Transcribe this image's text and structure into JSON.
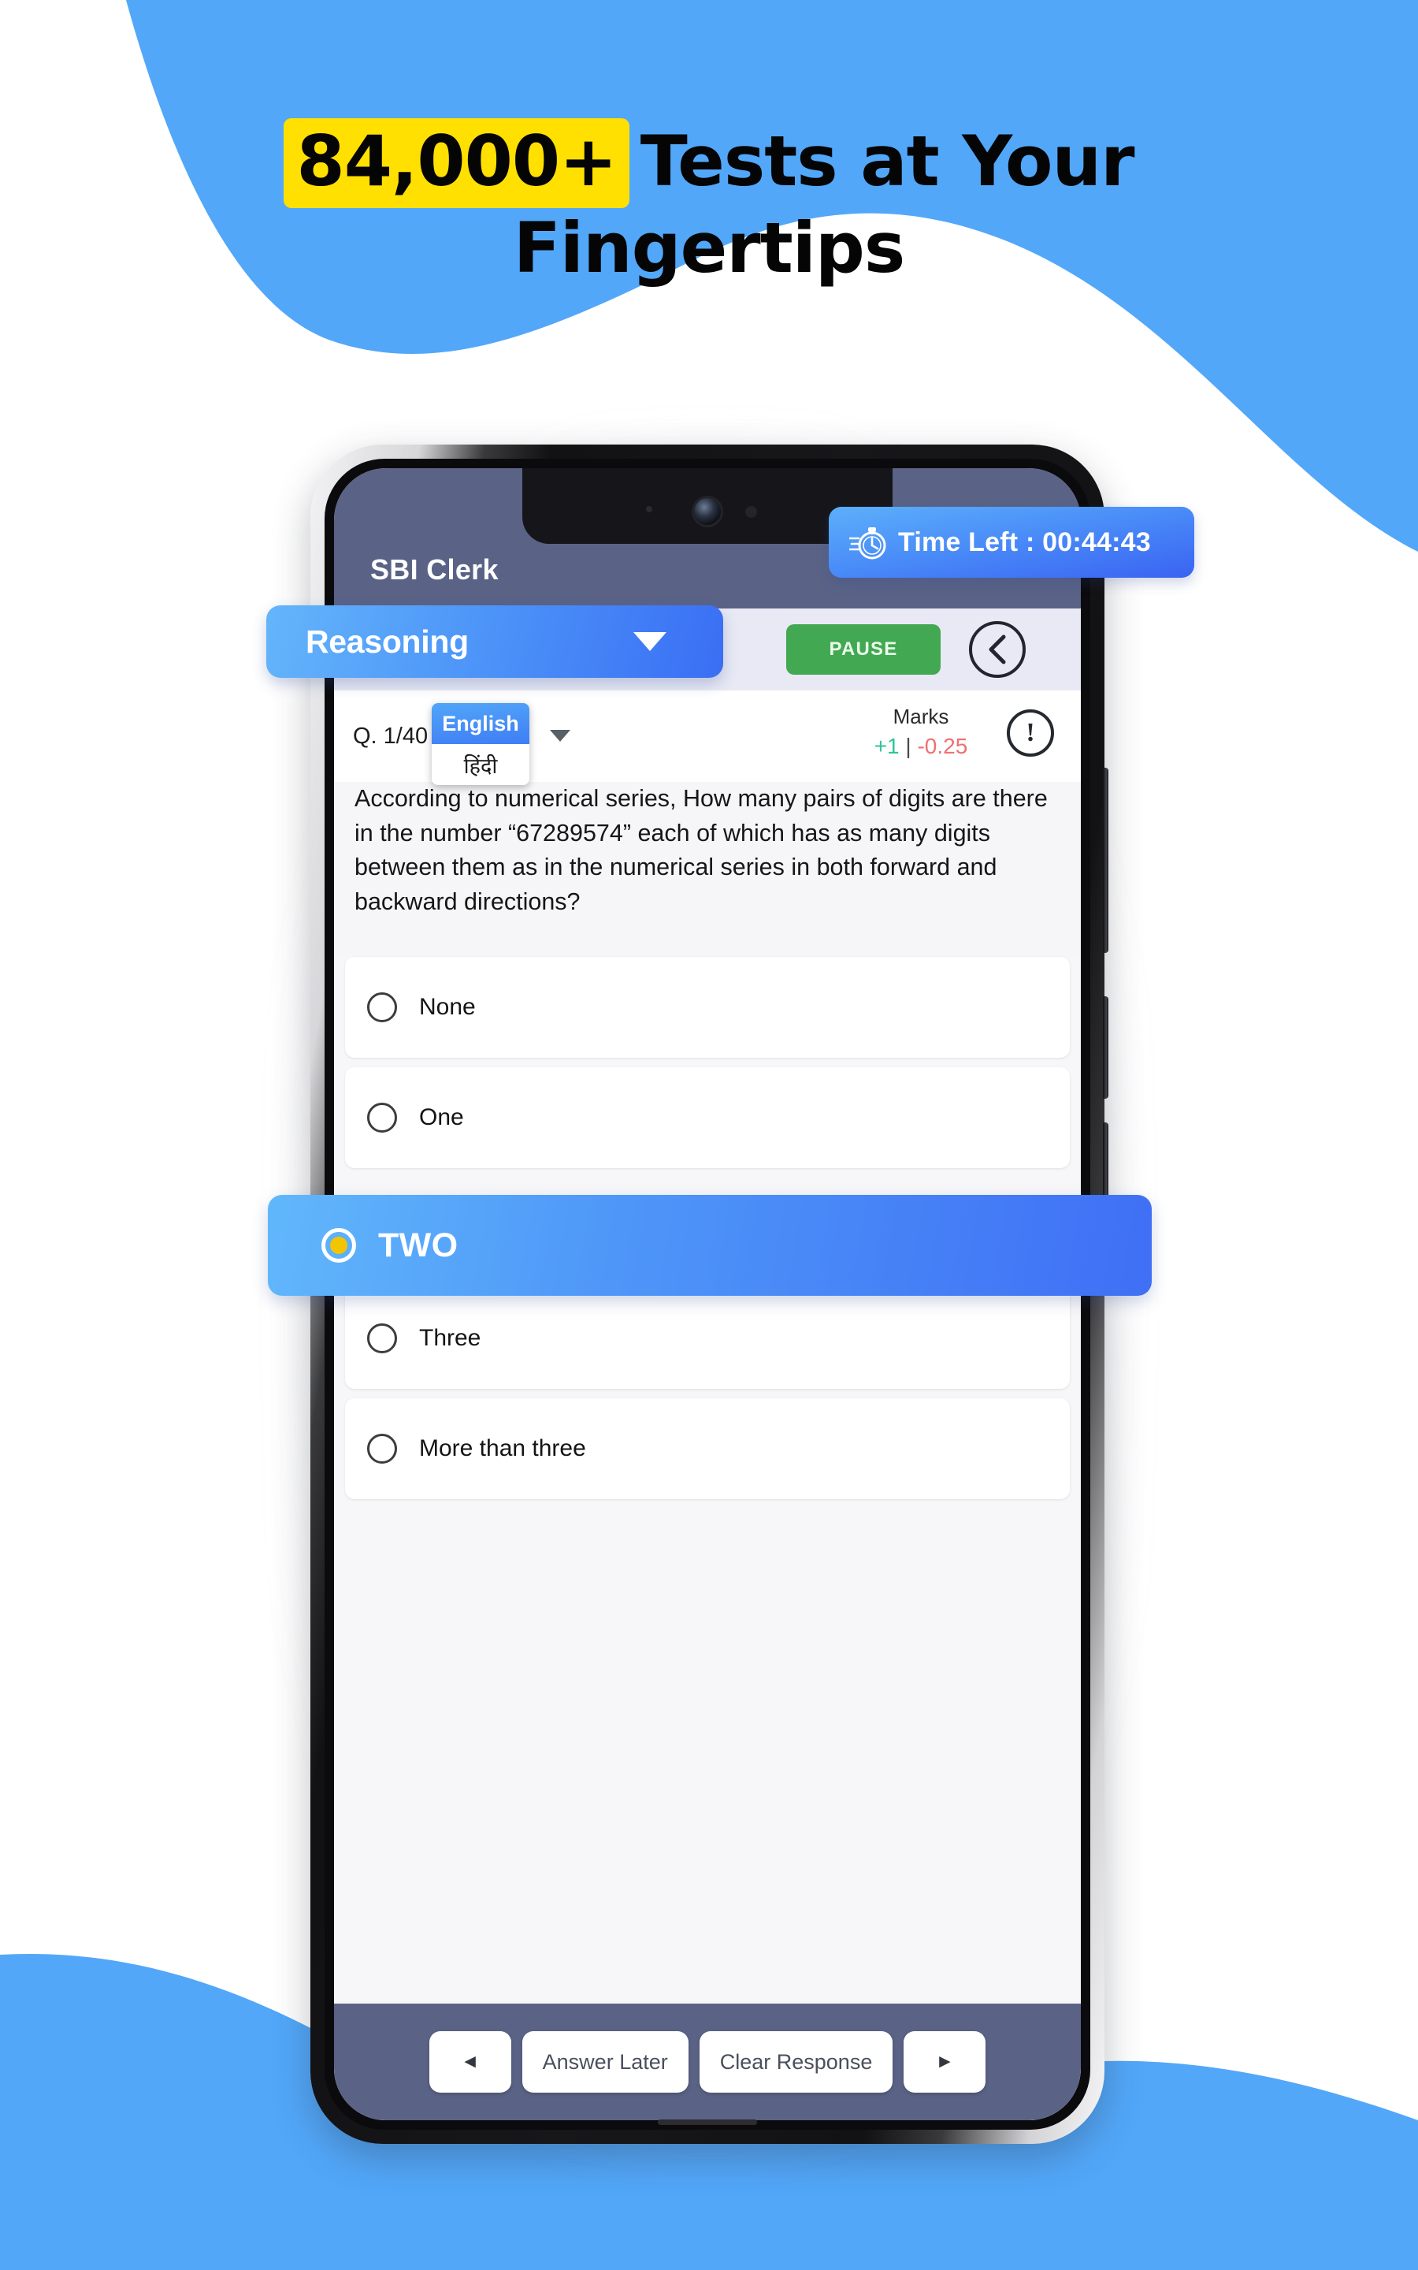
{
  "promo": {
    "headline_badge": "84,000+",
    "headline_rest": "Tests at Your",
    "headline_line2": "Fingertips",
    "badge_color": "#FFE000",
    "wave_color": "#52A7F9"
  },
  "app": {
    "title": "SBI Clerk",
    "header_bg": "#5a6386"
  },
  "timer": {
    "icon": "stopwatch-icon",
    "label": "Time Left : 00:44:43",
    "accent": "#3f72f5"
  },
  "toolbar": {
    "section_label": "Reasoning",
    "section_caret_icon": "chevron-down-icon",
    "pause_label": "PAUSE",
    "pause_color": "#42a851",
    "back_icon": "chevron-left-icon"
  },
  "question": {
    "counter": "Q. 1/40",
    "language_options": [
      "English",
      "हिंदी"
    ],
    "language_selected": "English",
    "language_caret_icon": "caret-down-icon",
    "marks_label": "Marks",
    "marks_positive": "+1",
    "marks_separator": "|",
    "marks_negative": "-0.25",
    "marks_positive_color": "#2fc39a",
    "marks_negative_color": "#ef6f72",
    "info_icon": "exclamation-circle-icon",
    "info_glyph": "!",
    "text": "According to numerical series, How many pairs of digits are there in the number “67289574” each of which has as many digits between them as in the numerical series in both forward and backward directions?"
  },
  "options": [
    {
      "label": "None",
      "selected": false
    },
    {
      "label": "One",
      "selected": false
    },
    {
      "label": "TWO",
      "selected": true
    },
    {
      "label": "Three",
      "selected": false
    },
    {
      "label": "More than three",
      "selected": false
    }
  ],
  "bottom_nav": {
    "prev_icon": "triangle-left-icon",
    "prev_glyph": "◄",
    "answer_later_label": "Answer Later",
    "clear_response_label": "Clear Response",
    "next_icon": "triangle-right-icon",
    "next_glyph": "►"
  }
}
